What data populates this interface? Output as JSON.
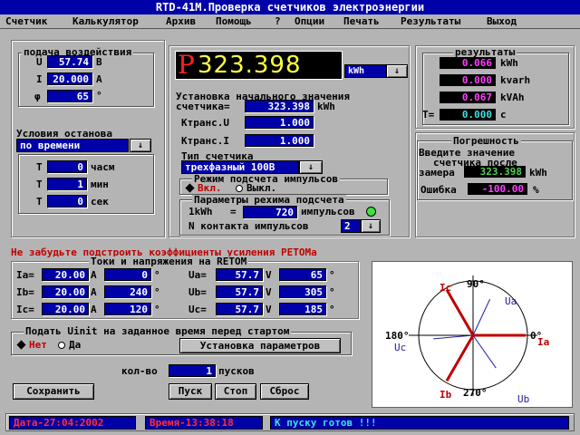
{
  "window": {
    "title": "RTD-41M.Проверка счетчиков электроэнергии"
  },
  "menu": [
    {
      "label": "Счетчик"
    },
    {
      "label": "Калькулятор"
    },
    {
      "label": "Архив"
    },
    {
      "label": "Помощь"
    },
    {
      "label": "?"
    },
    {
      "label": "Опции"
    },
    {
      "label": "Печать"
    },
    {
      "label": "Результаты"
    },
    {
      "label": "Выход"
    }
  ],
  "podacha": {
    "legend": "подача воздействия",
    "u_label": "U",
    "u_value": "57.74",
    "u_unit": "B",
    "i_label": "I",
    "i_value": "20.000",
    "i_unit": "A",
    "phi_label": "φ",
    "phi_value": "65",
    "phi_unit": "°"
  },
  "stop": {
    "legend": "Условия останова",
    "mode": "по времени",
    "t1_label": "T",
    "t1_value": "0",
    "t1_unit": "часм",
    "t2_label": "T",
    "t2_value": "1",
    "t2_unit": "мин",
    "t3_label": "T",
    "t3_value": "0",
    "t3_unit": "сек"
  },
  "display": {
    "letter": "P",
    "value": "323.398",
    "unit": "kWh",
    "unit_arrow": "↓"
  },
  "setup": {
    "initial_label_1": "Установка начального значения",
    "initial_label_2": "счетчика=",
    "initial_value": "323.398",
    "initial_unit": "kWh",
    "ktu_label": "Ктранс.U",
    "ktu_value": "1.000",
    "kti_label": "Ктранс.I",
    "kti_value": "1.000",
    "type_label": "Тип счетчика",
    "type_value": "трехфазный 100В",
    "impulse_mode_legend": "Режим подсчета импульсов",
    "on_label": "Вкл.",
    "off_label": "Выкл.",
    "params_legend": "Параметры рехима подсчета",
    "kwh_label": "1kWh",
    "kwh_eq": "=",
    "kwh_value": "720",
    "kwh_unit": "импульсов",
    "contact_label": "N контакта импульсов",
    "contact_value": "2"
  },
  "results": {
    "legend": "результаты",
    "r1_value": "0.066",
    "r1_unit": "kWh",
    "r2_value": "0.000",
    "r2_unit": "kvarh",
    "r3_value": "0.067",
    "r3_unit": "kVAh",
    "t_label": "T=",
    "t_value": "0.000",
    "t_unit": "c"
  },
  "error": {
    "legend": "Погрешность",
    "hint_1": "Введите значение",
    "hint_2": "счетчика после",
    "hint_3": "замера",
    "meas_value": "323.398",
    "meas_unit": "kWh",
    "err_label": "Ошибка",
    "err_value": "-100.00",
    "err_unit": "%"
  },
  "warning": "Не забудьте подстроить коэффициенты усиления РЕТОМа",
  "retom": {
    "legend": "Токи и напряжения на RETOM",
    "rows": [
      {
        "i_label": "Ia=",
        "i_value": "20.00",
        "i_unit": "A",
        "ia_value": "0",
        "ia_unit": "°",
        "u_label": "Ua=",
        "u_value": "57.7",
        "u_unit": "V",
        "ua_value": "65",
        "ua_unit": "°"
      },
      {
        "i_label": "Ib=",
        "i_value": "20.00",
        "i_unit": "A",
        "ia_value": "240",
        "ia_unit": "°",
        "u_label": "Ub=",
        "u_value": "57.7",
        "u_unit": "V",
        "ua_value": "305",
        "ua_unit": "°"
      },
      {
        "i_label": "Ic=",
        "i_value": "20.00",
        "i_unit": "A",
        "ia_value": "120",
        "ia_unit": "°",
        "u_label": "Uc=",
        "u_value": "57.7",
        "u_unit": "V",
        "ua_value": "185",
        "ua_unit": "°"
      }
    ]
  },
  "uinit": {
    "legend": "Подать Uinit на заданное время перед стартом",
    "no_label": "Нет",
    "yes_label": "Да",
    "button": "Установка параметров"
  },
  "runs": {
    "label": "кол-во",
    "value": "1",
    "unit": "пусков"
  },
  "buttons": {
    "save": "Сохранить",
    "start": "Пуск",
    "stop": "Стоп",
    "reset": "Сброс"
  },
  "status": {
    "date": "Дата-27:04:2002",
    "time": "Время-13:38:18",
    "message": "К пуску готов !!!"
  },
  "vector": {
    "labels": {
      "ua": "Ua",
      "ub": "Ub",
      "uc": "Uc",
      "ia": "Ia",
      "ib": "Ib",
      "ic": "Ic"
    },
    "deg90": "90°",
    "deg180": "180°",
    "deg0": "0°",
    "deg270": "270°",
    "i_color": "#c00000",
    "u_color": "#2020a0"
  },
  "colors": {
    "field_bg": "#0000a8",
    "panel_bg": "#b4b4b4",
    "accent_red": "#c00000",
    "status_green": "#50d050"
  }
}
